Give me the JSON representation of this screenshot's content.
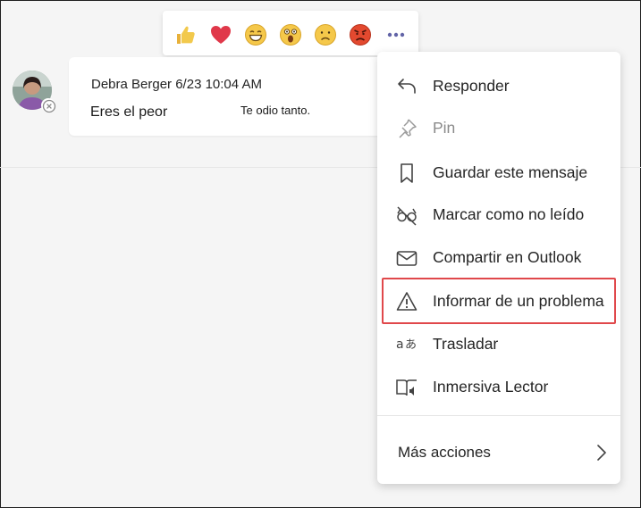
{
  "reactions": [
    {
      "name": "like-icon"
    },
    {
      "name": "heart-icon"
    },
    {
      "name": "laugh-icon"
    },
    {
      "name": "surprised-icon"
    },
    {
      "name": "sad-icon"
    },
    {
      "name": "angry-icon"
    }
  ],
  "message": {
    "sender": "Debra Berger",
    "timestamp": "6/23 10:04 AM",
    "header": "Debra Berger 6/23 10:04 AM",
    "text": "Eres el peor",
    "note": "Te odio tanto."
  },
  "menu": {
    "items": [
      {
        "label": "Responder",
        "icon": "reply-icon",
        "disabled": false
      },
      {
        "label": "Pin",
        "icon": "pin-icon",
        "disabled": true
      },
      {
        "label": "Guardar este mensaje",
        "icon": "bookmark-icon",
        "disabled": false
      },
      {
        "label": "Marcar como no leído",
        "icon": "unread-icon",
        "disabled": false
      },
      {
        "label": "Compartir en Outlook",
        "icon": "mail-icon",
        "disabled": false
      },
      {
        "label": "Informar de un problema",
        "icon": "warning-icon",
        "disabled": false,
        "highlighted": true
      },
      {
        "label": "Trasladar",
        "icon": "translate-icon",
        "disabled": false
      },
      {
        "label": "Inmersiva   Lector",
        "icon": "immersive-reader-icon",
        "disabled": false
      }
    ],
    "more": "Más acciones"
  },
  "colors": {
    "highlight": "#e0484b",
    "accent": "#6264a7"
  }
}
